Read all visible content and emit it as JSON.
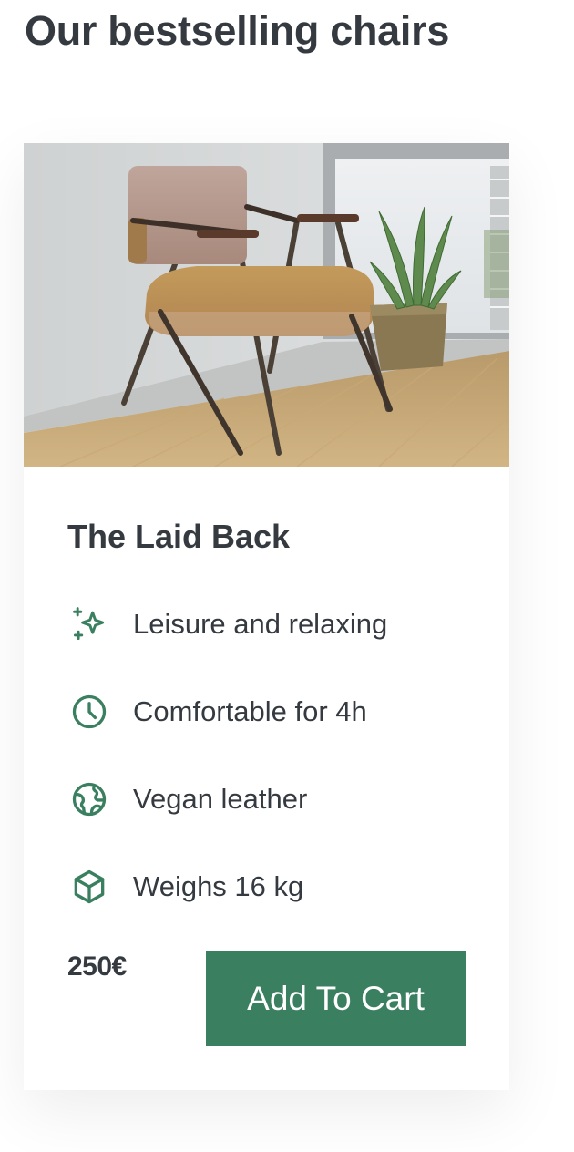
{
  "page": {
    "title": "Our bestselling chairs"
  },
  "product": {
    "image_alt": "Mid-century armchair with beige cushion next to a potted snake plant",
    "name": "The Laid Back",
    "features": [
      {
        "icon": "sparkles-icon",
        "text": "Leisure and relaxing"
      },
      {
        "icon": "clock-icon",
        "text": "Comfortable for 4h"
      },
      {
        "icon": "globe-icon",
        "text": "Vegan leather"
      },
      {
        "icon": "box-icon",
        "text": "Weighs 16 kg"
      }
    ],
    "price": "250€",
    "cta_label": "Add To Cart"
  },
  "colors": {
    "accent": "#3a7f5f",
    "text": "#343a40",
    "background": "#ffffff"
  }
}
